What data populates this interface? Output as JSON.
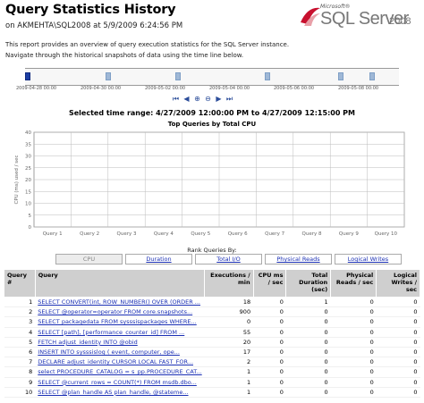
{
  "header": {
    "title": "Query Statistics History",
    "subtitle": "on AKMEHTA\\SQL2008 at 5/9/2009 6:24:56 PM",
    "logo_microsoft": "Microsoft®",
    "logo_product": "SQL Server",
    "logo_version": "2008"
  },
  "description": [
    "This report provides an overview of query execution statistics for the SQL Server instance.",
    "Navigate through the historical snapshots of data using the time line below."
  ],
  "timeline": {
    "ticks": [
      "2009-04-28 00:00",
      "2009-04-30 00:00",
      "2009-05-02 00:00",
      "2009-05-04 00:00",
      "2009-05-06 00:00",
      "2009-05-08 00:00"
    ]
  },
  "nav_icons": [
    "first-icon",
    "previous-icon",
    "zoom-in-icon",
    "zoom-out-icon",
    "next-icon",
    "last-icon"
  ],
  "selected_range": "Selected time range: 4/27/2009 12:00:00 PM to 4/27/2009 12:15:00 PM",
  "chart_data": {
    "type": "bar",
    "title": "Top Queries by Total CPU",
    "categories": [
      "Query 1",
      "Query 2",
      "Query 3",
      "Query 4",
      "Query 5",
      "Query 6",
      "Query 7",
      "Query 8",
      "Query 9",
      "Query 10"
    ],
    "values": [
      0,
      0,
      0,
      0,
      0,
      0,
      0,
      0,
      0,
      0
    ],
    "ylabel": "CPU (ms) used / sec",
    "xlabel": "",
    "yticks": [
      "0",
      "5",
      "10",
      "15",
      "20",
      "25",
      "30",
      "35",
      "40"
    ],
    "ylim": [
      0,
      40
    ],
    "grid": true,
    "colors": {
      "grid": "#bbbbbb",
      "axis": "#888888",
      "plot_bg": "#ffffff"
    }
  },
  "rank": {
    "label": "Rank Queries By:",
    "buttons": [
      "CPU",
      "Duration",
      "Total I/O",
      "Physical Reads",
      "Logical Writes"
    ],
    "active_index": 0
  },
  "table": {
    "headers": [
      "Query #",
      "Query",
      "Executions / min",
      "CPU ms / sec",
      "Total Duration (sec)",
      "Physical Reads / sec",
      "Logical Writes / sec"
    ],
    "rows": [
      [
        "1",
        "SELECT CONVERT(int, ROW_NUMBER() OVER (ORDER ...",
        "18",
        "0",
        "1",
        "0",
        "0"
      ],
      [
        "2",
        "SELECT @operator=operator FROM core.snapshots...",
        "900",
        "0",
        "0",
        "0",
        "0"
      ],
      [
        "3",
        "SELECT packagedata FROM sysssispackages WHERE...",
        "0",
        "0",
        "0",
        "0",
        "0"
      ],
      [
        "4",
        "SELECT [path], [performance_counter_id] FROM ...",
        "55",
        "0",
        "0",
        "0",
        "0"
      ],
      [
        "5",
        "FETCH adjust_identity INTO @obid",
        "20",
        "0",
        "0",
        "0",
        "0"
      ],
      [
        "6",
        "INSERT INTO sysssislog ( event, computer, ope...",
        "17",
        "0",
        "0",
        "0",
        "0"
      ],
      [
        "7",
        "DECLARE adjust_identity CURSOR LOCAL FAST_FOR...",
        "2",
        "0",
        "0",
        "0",
        "0"
      ],
      [
        "8",
        "select PROCEDURE_CATALOG = s_pp.PROCEDURE_CAT...",
        "1",
        "0",
        "0",
        "0",
        "0"
      ],
      [
        "9",
        "SELECT @current_rows = COUNT(*) FROM msdb.dbo...",
        "1",
        "0",
        "0",
        "0",
        "0"
      ],
      [
        "10",
        "SELECT @plan_handle AS plan_handle, @stateme...",
        "1",
        "0",
        "0",
        "0",
        "0"
      ]
    ]
  }
}
